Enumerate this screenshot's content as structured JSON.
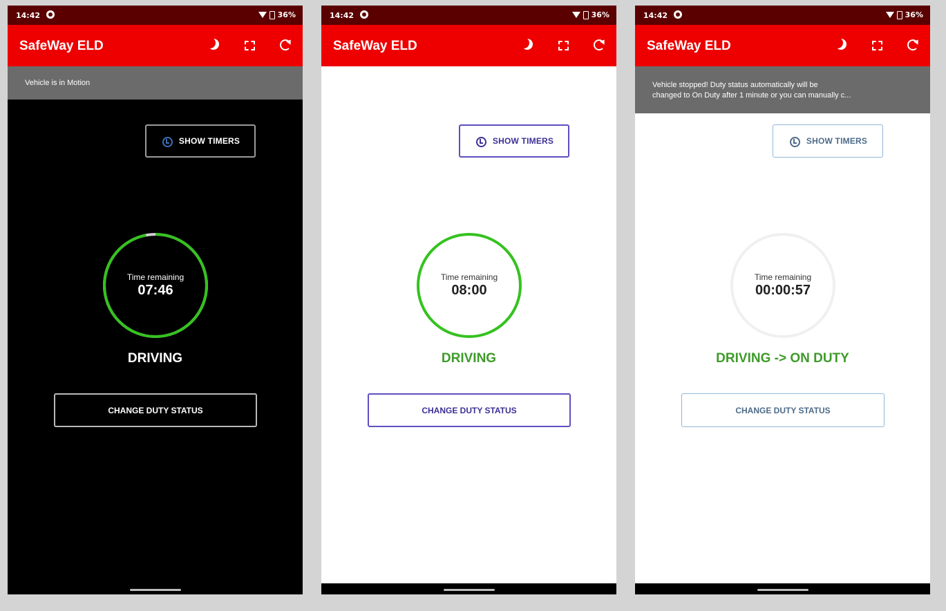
{
  "status_bar": {
    "time": "14:42",
    "battery": "36%"
  },
  "app": {
    "title": "SafeWay ELD"
  },
  "colors": {
    "app_bar": "#ee0000",
    "status_bar": "#5b0000",
    "ring_green": "#35c21f",
    "status_green": "#3e9b2a",
    "banner_gray": "#6b6b6b"
  },
  "icons": [
    "moon-icon",
    "fullscreen-icon",
    "refresh-icon",
    "alarm-clock-icon"
  ],
  "screens": [
    {
      "theme": "dark",
      "banner": [
        "Vehicle is in Motion"
      ],
      "timers_button": "SHOW TIMERS",
      "time_remaining_label": "Time remaining",
      "time_remaining_value": "07:46",
      "ring_progress": 0.97,
      "duty_status": "DRIVING",
      "change_button": "CHANGE DUTY STATUS"
    },
    {
      "theme": "light",
      "banner": [],
      "timers_button": "SHOW TIMERS",
      "time_remaining_label": "Time remaining",
      "time_remaining_value": "08:00",
      "ring_progress": 1.0,
      "duty_status": "DRIVING",
      "change_button": "CHANGE DUTY STATUS"
    },
    {
      "theme": "light",
      "banner": [
        "Vehicle stopped! Duty status automatically will be",
        "changed to On Duty after 1 minute or you can manually c..."
      ],
      "timers_button": "SHOW TIMERS",
      "time_remaining_label": "Time remaining",
      "time_remaining_value": "00:00:57",
      "ring_progress": 0.0,
      "duty_status": "DRIVING -> ON DUTY",
      "change_button": "CHANGE DUTY STATUS"
    }
  ]
}
